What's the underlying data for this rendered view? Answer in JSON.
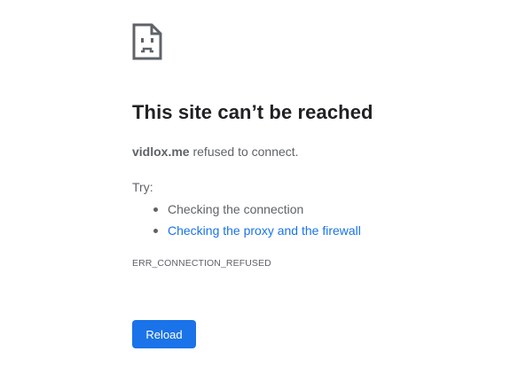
{
  "icon": "sad-page-icon",
  "title": "This site can’t be reached",
  "description": {
    "host": "vidlox.me",
    "message": " refused to connect."
  },
  "try_label": "Try:",
  "suggestions": [
    {
      "label": "Checking the connection",
      "is_link": false
    },
    {
      "label": "Checking the proxy and the firewall",
      "is_link": true
    }
  ],
  "error_code": "ERR_CONNECTION_REFUSED",
  "reload_label": "Reload",
  "colors": {
    "accent": "#1a73e8",
    "title": "#202124",
    "text": "#5f6368"
  }
}
